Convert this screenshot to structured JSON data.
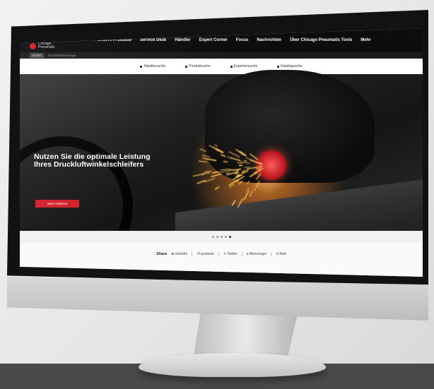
{
  "brand": {
    "logo_text": "Chicago Pneumatic",
    "accent": "#d2202a"
  },
  "nav": {
    "items": [
      "Unsere Produkte",
      "Service Desk",
      "Händler",
      "Expert Corner",
      "Focus",
      "Nachrichten",
      "Über Chicago Pneumatic Tools",
      "Mehr"
    ]
  },
  "breadcrumb": {
    "home": "Home",
    "current": "Druckluftwerkzeuge"
  },
  "subnav": {
    "items": [
      "Händlersuche",
      "Produktsuche",
      "Expertensuche",
      "Katalogsuche"
    ]
  },
  "hero": {
    "headline": "Nutzen Sie die optimale Leistung Ihres Druckluftwinkelschleifers",
    "cta": "Mehr erfahren"
  },
  "carousel": {
    "slide_count": 5,
    "active_index": 4
  },
  "share": {
    "label": "Share",
    "items": [
      {
        "icon": "linkedin-icon",
        "label": "LinkedIn"
      },
      {
        "icon": "facebook-icon",
        "label": "Facebook"
      },
      {
        "icon": "twitter-icon",
        "label": "Twitter"
      },
      {
        "icon": "messenger-icon",
        "label": "Messenger"
      },
      {
        "icon": "mail-icon",
        "label": "Mail"
      }
    ]
  }
}
